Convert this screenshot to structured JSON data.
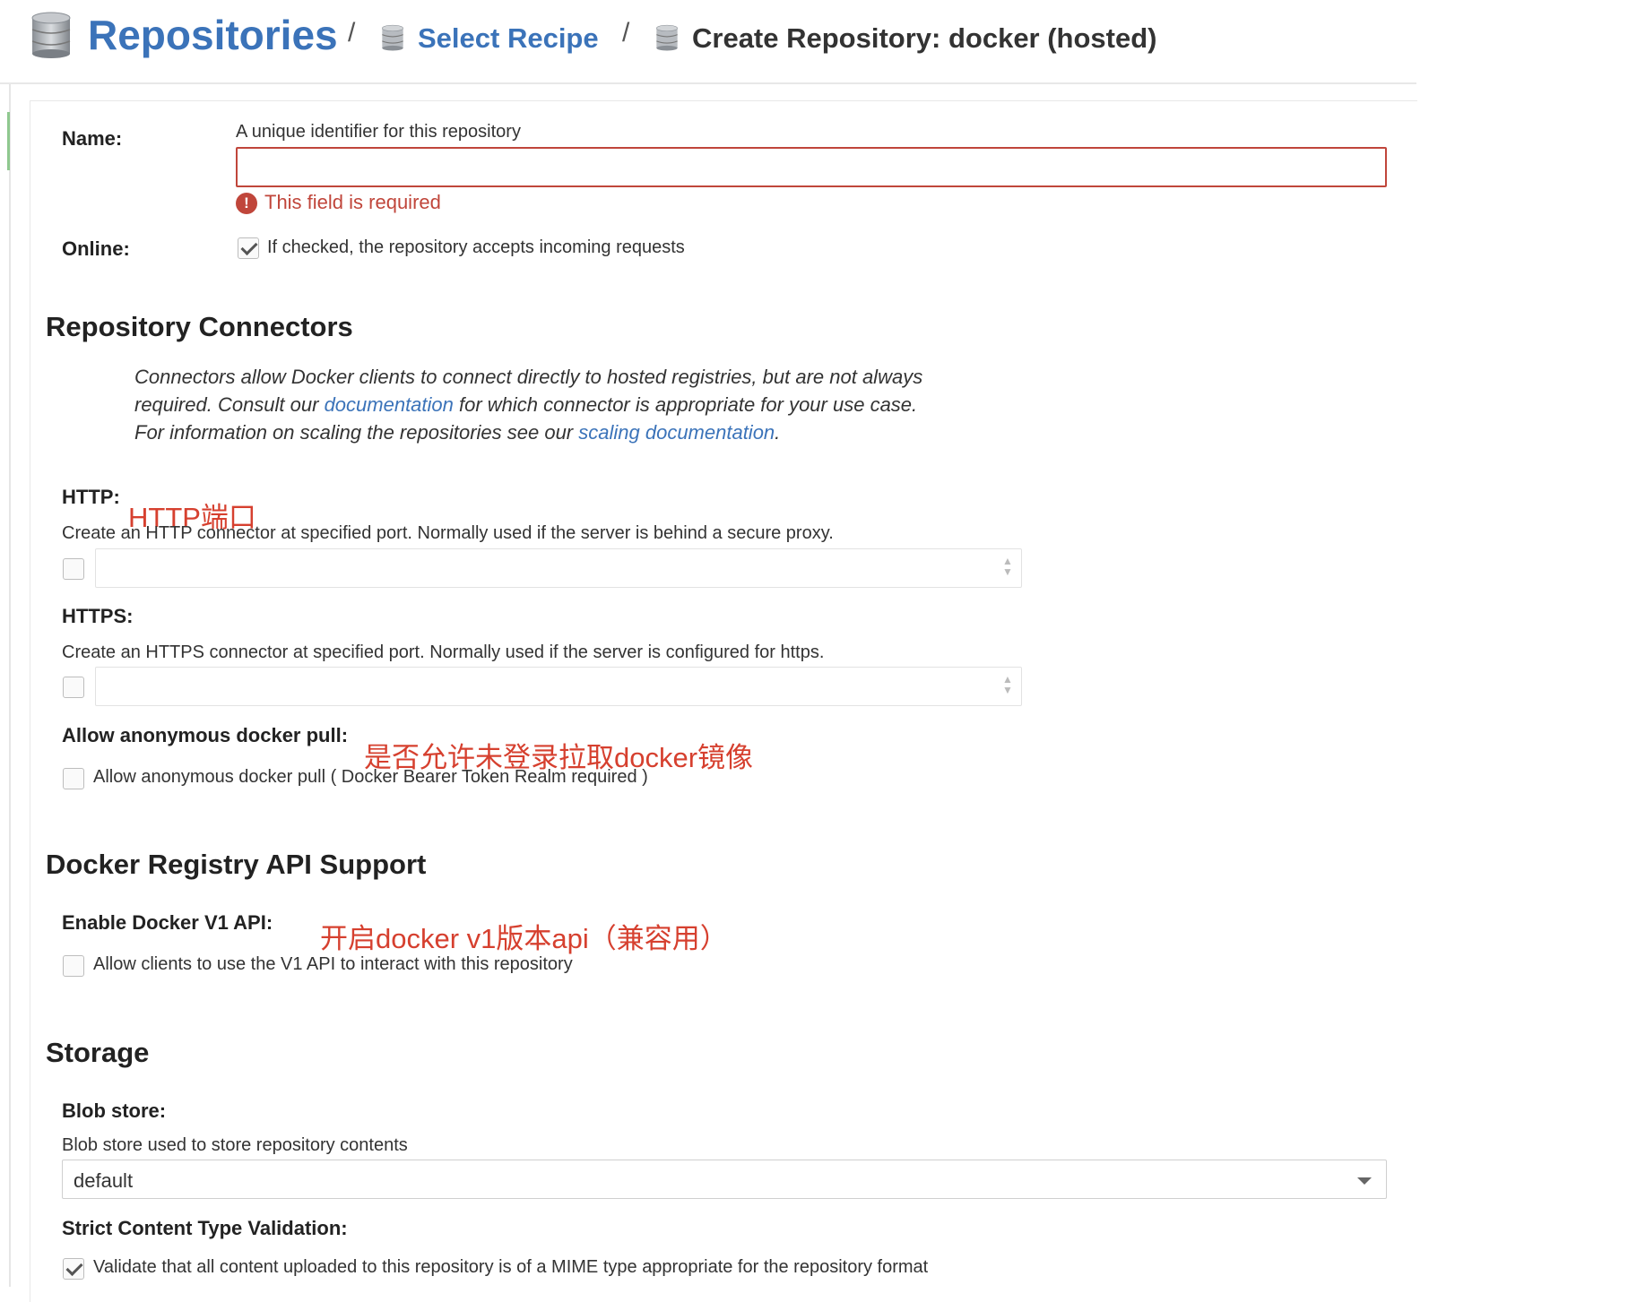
{
  "breadcrumb": {
    "root": "Repositories",
    "separator": "/",
    "step": "Select Recipe",
    "current": "Create Repository: docker (hosted)"
  },
  "name_field": {
    "label": "Name:",
    "help": "A unique identifier for this repository",
    "value": "",
    "error": "This field is required",
    "error_icon": "!"
  },
  "online_field": {
    "label": "Online:",
    "checked": true,
    "help": "If checked, the repository accepts incoming requests"
  },
  "connectors": {
    "title": "Repository Connectors",
    "desc_part1": "Connectors allow Docker clients to connect directly to hosted registries, but are not always required. Consult our ",
    "doc_link": "documentation",
    "desc_part2": " for which connector is appropriate for your use case. For information on scaling the repositories see our ",
    "scaling_link": "scaling documentation",
    "desc_end": ".",
    "http": {
      "label": "HTTP:",
      "help": "Create an HTTP connector at specified port. Normally used if the server is behind a secure proxy.",
      "checked": false,
      "value": ""
    },
    "https": {
      "label": "HTTPS:",
      "help": "Create an HTTPS connector at specified port. Normally used if the server is configured for https.",
      "checked": false,
      "value": ""
    },
    "anonymous": {
      "label": "Allow anonymous docker pull:",
      "checked": false,
      "help": "Allow anonymous docker pull ( Docker Bearer Token Realm required )"
    }
  },
  "api_support": {
    "title": "Docker Registry API Support",
    "v1": {
      "label": "Enable Docker V1 API:",
      "checked": false,
      "help": "Allow clients to use the V1 API to interact with this repository"
    }
  },
  "storage": {
    "title": "Storage",
    "blob": {
      "label": "Blob store:",
      "help": "Blob store used to store repository contents",
      "selected": "default"
    },
    "strict": {
      "label": "Strict Content Type Validation:",
      "checked": true,
      "help": "Validate that all content uploaded to this repository is of a MIME type appropriate for the repository format"
    }
  },
  "annotations": {
    "http_port": "HTTP端口",
    "anonymous_pull": "是否允许未登录拉取docker镜像",
    "v1_api": "开启docker v1版本api（兼容用）"
  },
  "colors": {
    "link": "#3b73b9",
    "error": "#c0463b",
    "annotation": "#d6402f"
  },
  "icons": {
    "breadcrumb_root": "database-icon",
    "breadcrumb_step": "database-icon",
    "breadcrumb_current": "database-icon",
    "spinner": "spinner-arrows-icon",
    "select": "chevron-down-icon"
  }
}
